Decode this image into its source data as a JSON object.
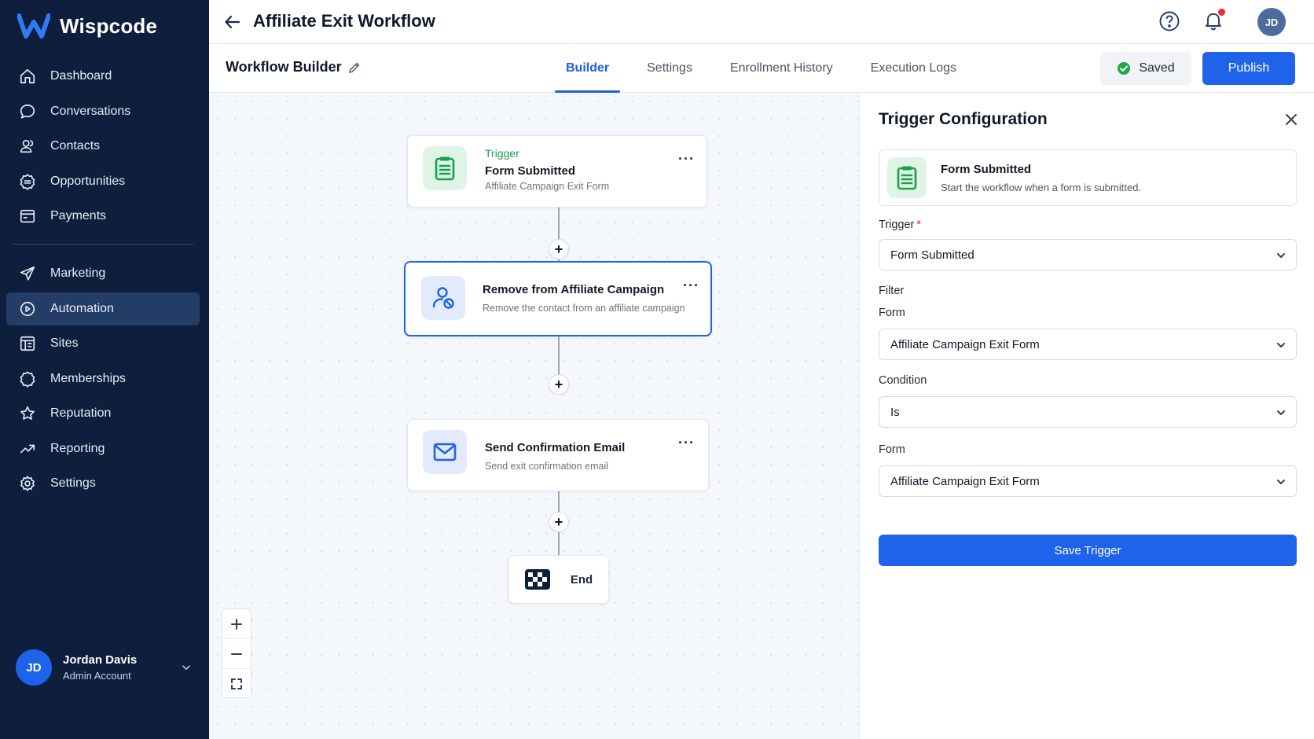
{
  "brand": {
    "name": "Wispcode",
    "logo_icon": "w-logo-icon",
    "accent": "#1e63e9"
  },
  "sidebar": {
    "items": [
      {
        "label": "Dashboard",
        "icon": "home-icon"
      },
      {
        "label": "Conversations",
        "icon": "chat-icon"
      },
      {
        "label": "Contacts",
        "icon": "users-icon"
      },
      {
        "label": "Opportunities",
        "icon": "badge-icon"
      },
      {
        "label": "Payments",
        "icon": "card-icon"
      },
      {
        "label": "Marketing",
        "icon": "send-icon"
      },
      {
        "label": "Automation",
        "icon": "automation-icon",
        "active": true
      },
      {
        "label": "Sites",
        "icon": "layout-icon"
      },
      {
        "label": "Memberships",
        "icon": "badge-star-icon"
      },
      {
        "label": "Reputation",
        "icon": "star-icon"
      },
      {
        "label": "Reporting",
        "icon": "trend-icon"
      },
      {
        "label": "Settings",
        "icon": "gear-icon"
      }
    ],
    "user": {
      "initials": "JD",
      "name": "Jordan Davis",
      "role": "Admin Account"
    }
  },
  "header": {
    "title": "Affiliate Exit Workflow",
    "avatar_initials": "JD",
    "notification_dot_color": "#ef2b2b"
  },
  "subheader": {
    "title": "Workflow Builder",
    "tabs": [
      {
        "label": "Builder",
        "active": true
      },
      {
        "label": "Settings"
      },
      {
        "label": "Enrollment History"
      },
      {
        "label": "Execution Logs"
      }
    ],
    "saved_label": "Saved",
    "publish_label": "Publish"
  },
  "canvas": {
    "nodes": {
      "trigger": {
        "kicker": "Trigger",
        "title": "Form Submitted",
        "subtitle": "Affiliate Campaign Exit Form",
        "more": "···"
      },
      "remove": {
        "title": "Remove from Affiliate Campaign",
        "subtitle": "Remove the contact from an affiliate campaign",
        "more": "···"
      },
      "email": {
        "title": "Send Confirmation Email",
        "subtitle": "Send exit confirmation email",
        "more": "···"
      },
      "end": {
        "label": "End"
      }
    },
    "add_step_label": "+"
  },
  "panel": {
    "title": "Trigger Configuration",
    "card": {
      "title": "Form Submitted",
      "subtitle": "Start the workflow when a form is submitted."
    },
    "trigger_label": "Trigger",
    "required_mark": "*",
    "trigger_value": "Form Submitted",
    "filter_label": "Filter",
    "form_label": "Form",
    "form_value": "Affiliate Campaign Exit Form",
    "condition_label": "Condition",
    "condition_value": "Is",
    "form2_label": "Form",
    "form2_value": "Affiliate Campaign Exit Form",
    "save_label": "Save Trigger"
  }
}
